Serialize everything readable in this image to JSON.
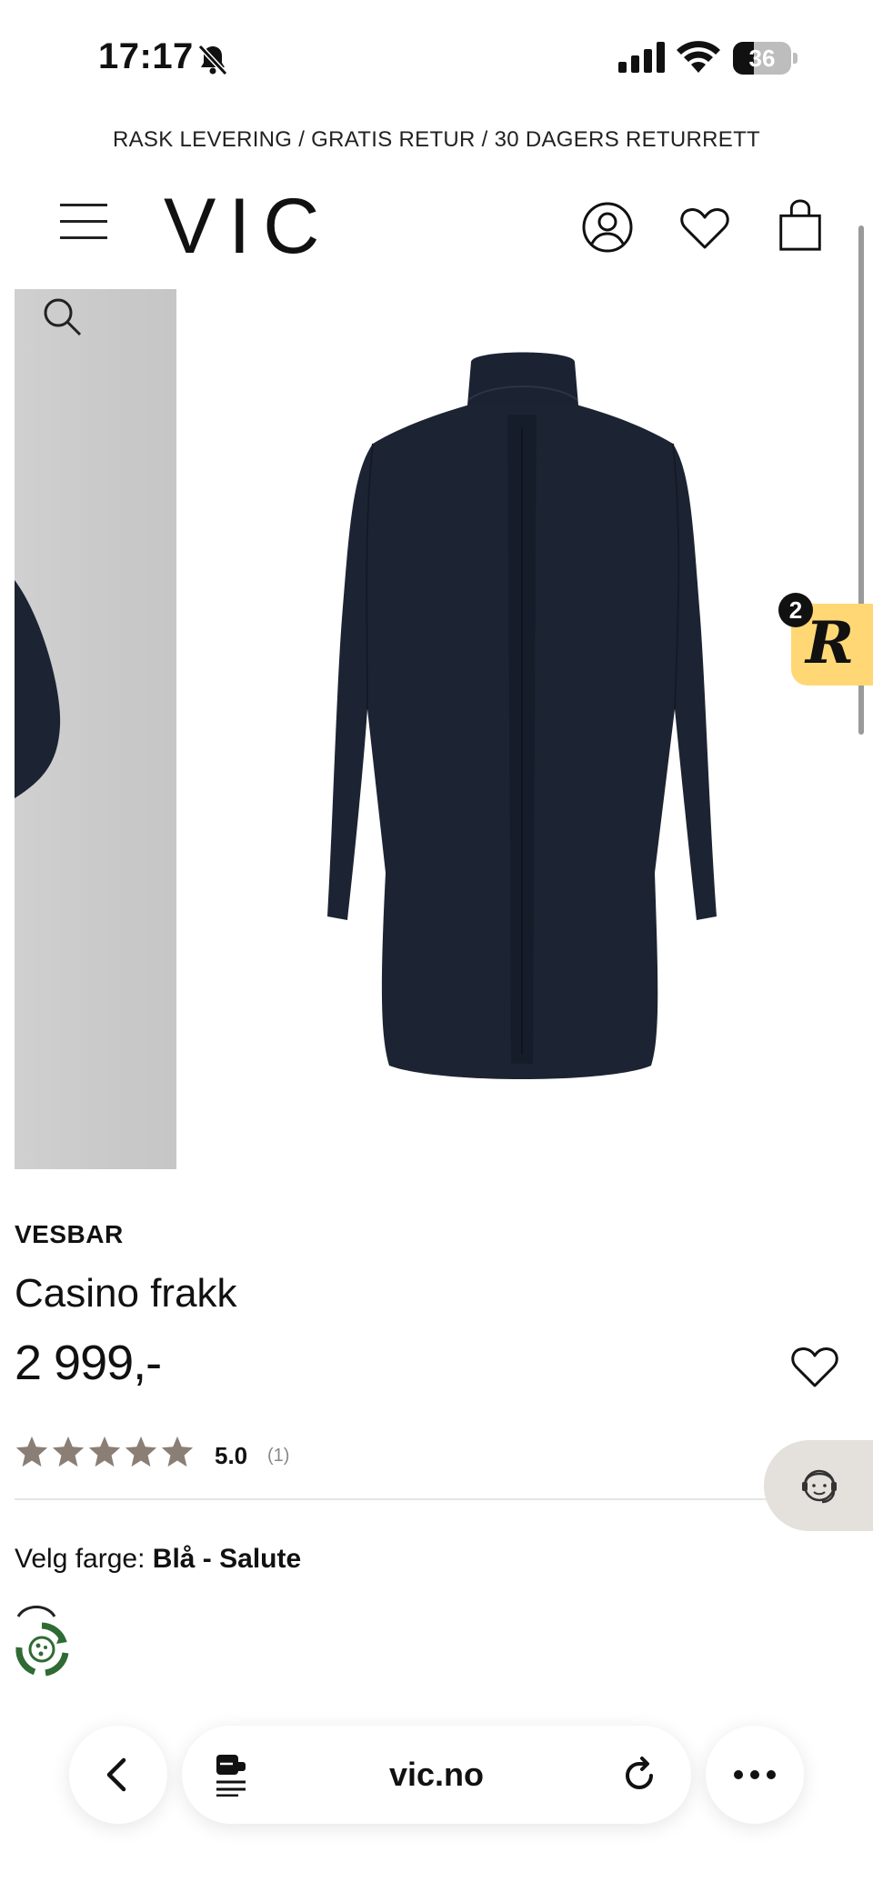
{
  "status_bar": {
    "time": "17:17",
    "battery": "36",
    "battery_level": 0.36
  },
  "promo": {
    "text": "RASK LEVERING / GRATIS RETUR / 30 DAGERS RETURRETT"
  },
  "header": {
    "logo": "VIC"
  },
  "badge": {
    "count": "2",
    "letter": "R"
  },
  "product": {
    "brand": "VESBAR",
    "name": "Casino frakk",
    "price": "2 999,-",
    "rating_value": "5.0",
    "rating_count": "(1)",
    "stars": 5,
    "color_label": "Velg farge: ",
    "color_value": "Blå - Salute"
  },
  "browser": {
    "url": "vic.no"
  },
  "colors": {
    "badge": "#ffd875",
    "star": "#8a7e75",
    "coat": "#1c2433",
    "support_bg": "#e4e0dc"
  }
}
